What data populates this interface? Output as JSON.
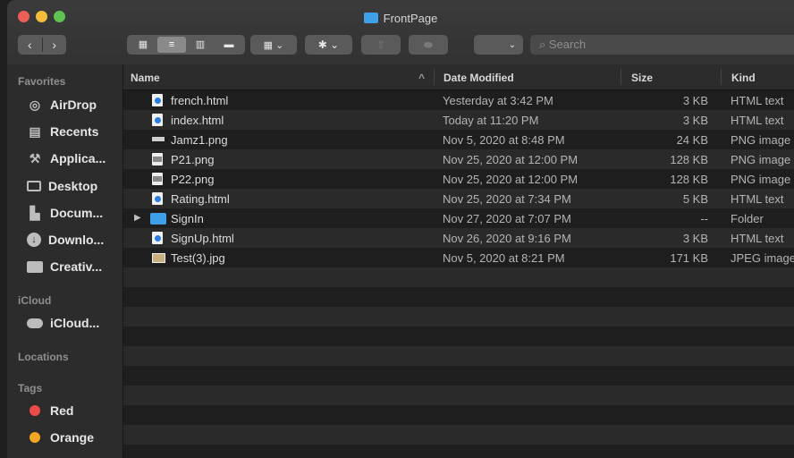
{
  "window": {
    "title": "FrontPage"
  },
  "toolbar": {
    "back": "‹",
    "forward": "›",
    "views": [
      "▦",
      "≡",
      "▥",
      "▬"
    ],
    "group": "▦ ⌄",
    "action": "✱ ⌄",
    "share": "⇧",
    "tag": "⬬",
    "path": "⌄",
    "search_placeholder": "Search",
    "search_icon": "⌕"
  },
  "sidebar": {
    "favorites_header": "Favorites",
    "favorites": [
      {
        "label": "AirDrop",
        "icon": "airdrop-icon"
      },
      {
        "label": "Recents",
        "icon": "recents-icon"
      },
      {
        "label": "Applica...",
        "icon": "applications-icon"
      },
      {
        "label": "Desktop",
        "icon": "desktop-icon"
      },
      {
        "label": "Docum...",
        "icon": "documents-icon"
      },
      {
        "label": "Downlo...",
        "icon": "downloads-icon"
      },
      {
        "label": "Creativ...",
        "icon": "folder-icon"
      }
    ],
    "icloud_header": "iCloud",
    "icloud": [
      {
        "label": "iCloud...",
        "icon": "cloud-icon"
      }
    ],
    "locations_header": "Locations",
    "tags_header": "Tags",
    "tags": [
      {
        "label": "Red",
        "color": "#ed4b47"
      },
      {
        "label": "Orange",
        "color": "#f5a623"
      }
    ]
  },
  "columns": {
    "name": "Name",
    "sort_indicator": "^",
    "date": "Date Modified",
    "size": "Size",
    "kind": "Kind"
  },
  "files": [
    {
      "name": "french.html",
      "date": "Yesterday at 3:42 PM",
      "size": "3 KB",
      "kind": "HTML text",
      "icon": "html-file-icon"
    },
    {
      "name": "index.html",
      "date": "Today at 11:20 PM",
      "size": "3 KB",
      "kind": "HTML text",
      "icon": "html-file-icon"
    },
    {
      "name": "Jamz1.png",
      "date": "Nov 5, 2020 at 8:48 PM",
      "size": "24 KB",
      "kind": "PNG image",
      "icon": "png-file-icon"
    },
    {
      "name": "P21.png",
      "date": "Nov 25, 2020 at 12:00 PM",
      "size": "128 KB",
      "kind": "PNG image",
      "icon": "png-file-icon"
    },
    {
      "name": "P22.png",
      "date": "Nov 25, 2020 at 12:00 PM",
      "size": "128 KB",
      "kind": "PNG image",
      "icon": "png-file-icon"
    },
    {
      "name": "Rating.html",
      "date": "Nov 25, 2020 at 7:34 PM",
      "size": "5 KB",
      "kind": "HTML text",
      "icon": "html-file-icon"
    },
    {
      "name": "SignIn",
      "date": "Nov 27, 2020 at 7:07 PM",
      "size": "--",
      "kind": "Folder",
      "icon": "folder-icon",
      "disclosure": "▶"
    },
    {
      "name": "SignUp.html",
      "date": "Nov 26, 2020 at 9:16 PM",
      "size": "3 KB",
      "kind": "HTML text",
      "icon": "html-file-icon"
    },
    {
      "name": "Test(3).jpg",
      "date": "Nov 5, 2020 at 8:21 PM",
      "size": "171 KB",
      "kind": "JPEG image",
      "icon": "jpeg-file-icon"
    }
  ]
}
